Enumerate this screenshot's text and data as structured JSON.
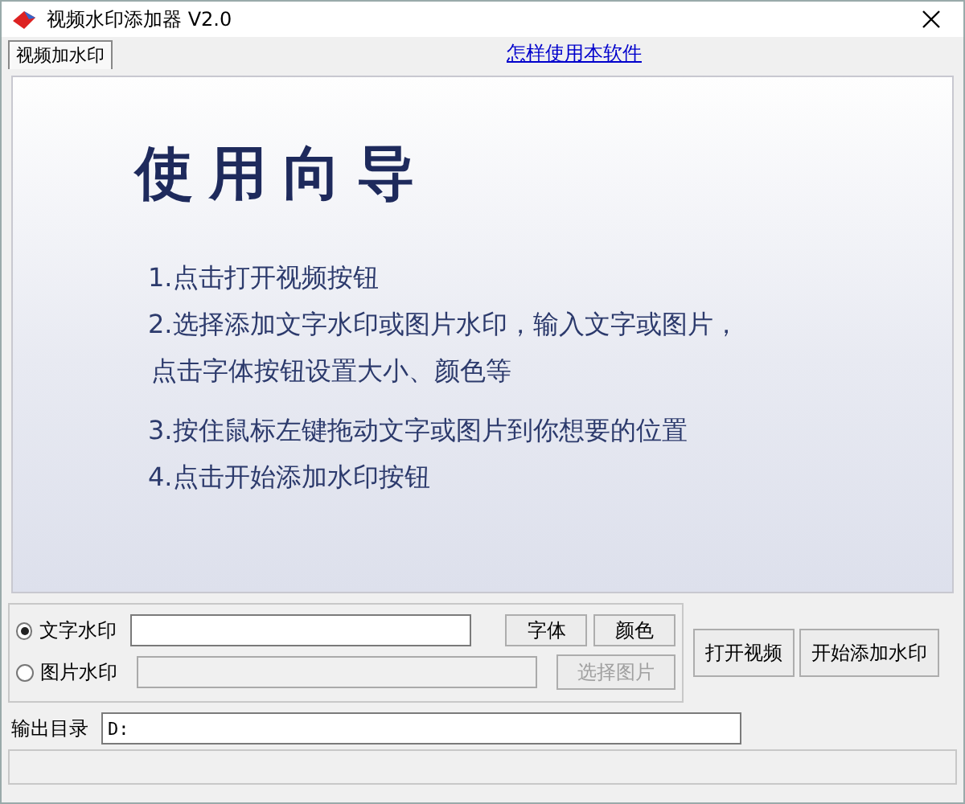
{
  "window": {
    "title": "视频水印添加器 V2.0"
  },
  "tabs": [
    {
      "label": "视频加水印",
      "selected": true
    }
  ],
  "help_link": "怎样使用本软件",
  "guide": {
    "title": "使用向导",
    "steps": [
      {
        "kind": "step",
        "text": "1.点击打开视频按钮"
      },
      {
        "kind": "step",
        "text": "2.选择添加文字水印或图片水印，输入文字或图片，"
      },
      {
        "kind": "continuation",
        "text": "点击字体按钮设置大小、颜色等"
      },
      {
        "kind": "step",
        "text": "3.按住鼠标左键拖动文字或图片到你想要的位置"
      },
      {
        "kind": "step",
        "text": "4.点击开始添加水印按钮"
      }
    ]
  },
  "watermark_options": [
    {
      "label": "文字水印",
      "selected": true,
      "disabled": false,
      "buttons": [
        {
          "label": "字体",
          "disabled": false
        },
        {
          "label": "颜色",
          "disabled": false
        }
      ]
    },
    {
      "label": "图片水印",
      "selected": false,
      "disabled": true,
      "buttons": [
        {
          "label": "选择图片",
          "disabled": true
        }
      ]
    }
  ],
  "actions": [
    "打开视频",
    "开始添加水印"
  ],
  "output": {
    "label": "输出目录",
    "value": "D:"
  }
}
